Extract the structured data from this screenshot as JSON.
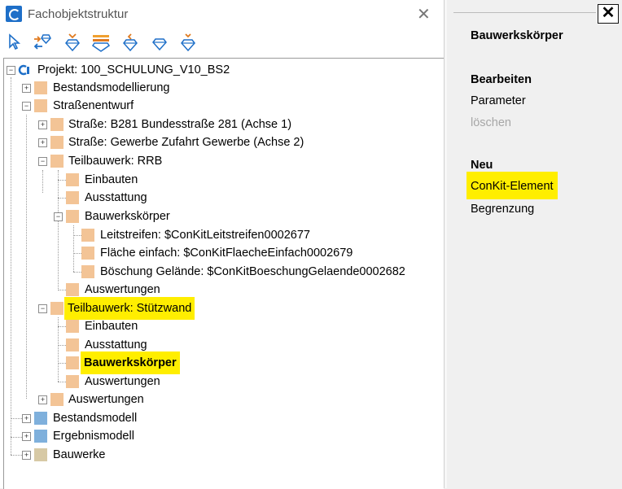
{
  "window": {
    "title": "Fachobjektstruktur",
    "close_glyph": "✕"
  },
  "toolbar": {
    "icons": [
      "pointer-icon",
      "transfer-icon",
      "diamond-down-icon",
      "stack-icon",
      "diamond-left-icon",
      "diamond-icon",
      "diamond-down-arrow-icon"
    ]
  },
  "tree": {
    "project": "Projekt: 100_SCHULUNG_V10_BS2",
    "bestandsmodellierung": "Bestandsmodellierung",
    "strassenentwurf": "Straßenentwurf",
    "strasse1": "Straße: B281 Bundesstraße 281 (Achse 1)",
    "strasse2": "Straße: Gewerbe Zufahrt Gewerbe (Achse 2)",
    "rrb": "Teilbauwerk: RRB",
    "rrb_einbauten": "Einbauten",
    "rrb_ausstattung": "Ausstattung",
    "rrb_bauwerkskoerper": "Bauwerkskörper",
    "leitstreifen": "Leitstreifen: $ConKitLeitstreifen0002677",
    "flaeche": "Fläche einfach: $ConKitFlaecheEinfach0002679",
    "boeschung": "Böschung Gelände: $ConKitBoeschungGelaende0002682",
    "rrb_auswertungen": "Auswertungen",
    "stuetzwand": "Teilbauwerk: Stützwand",
    "sw_einbauten": "Einbauten",
    "sw_ausstattung": "Ausstattung",
    "sw_bauwerkskoerper": "Bauwerkskörper",
    "sw_auswertungen": "Auswertungen",
    "auswertungen": "Auswertungen",
    "bestandsmodell": "Bestandsmodell",
    "ergebnismodell": "Ergebnismodell",
    "bauwerke": "Bauwerke"
  },
  "panel": {
    "close_glyph": "✕",
    "heading": "Bauwerkskörper",
    "section1": "Bearbeiten",
    "parameter": "Parameter",
    "loeschen": "löschen",
    "section2": "Neu",
    "conkit": "ConKit-Element",
    "begrenzung": "Begrenzung"
  },
  "colors": {
    "folder_orange": "#f3c496",
    "folder_blue": "#7fb0dc",
    "folder_khaki": "#d7c9a5",
    "highlight": "#ffee00",
    "icon_blue": "#1e6fc8"
  }
}
